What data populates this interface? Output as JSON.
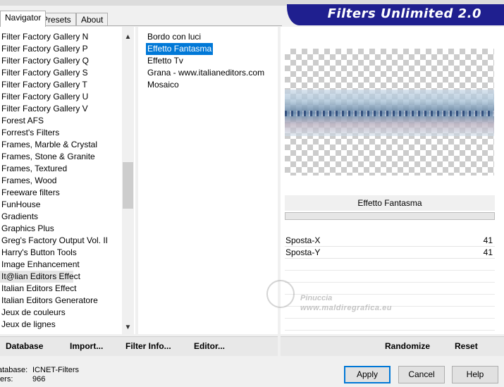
{
  "tabs": [
    {
      "label": "Navigator",
      "active": true
    },
    {
      "label": "Presets",
      "active": false
    },
    {
      "label": "About",
      "active": false
    }
  ],
  "banner": {
    "title": "Filters Unlimited 2.0"
  },
  "categories": [
    "Filter Factory Gallery N",
    "Filter Factory Gallery P",
    "Filter Factory Gallery Q",
    "Filter Factory Gallery S",
    "Filter Factory Gallery T",
    "Filter Factory Gallery U",
    "Filter Factory Gallery V",
    "Forest AFS",
    "Forrest's Filters",
    "Frames, Marble & Crystal",
    "Frames, Stone & Granite",
    "Frames, Textured",
    "Frames, Wood",
    "Freeware filters",
    "FunHouse",
    "Gradients",
    "Graphics Plus",
    "Greg's Factory Output Vol. II",
    "Harry's Button Tools",
    "Image Enhancement",
    "It@lian Editors Effect",
    "Italian Editors Effect",
    "Italian Editors Generatore",
    "Jeux de couleurs",
    "Jeux de lignes"
  ],
  "selected_category": "It@lian Editors Effect",
  "filters": [
    "Bordo con luci",
    "Effetto Fantasma",
    "Effetto Tv",
    "Grana - www.italianeditors.com",
    "Mosaico"
  ],
  "selected_filter": "Effetto Fantasma",
  "filter_name": "Effetto Fantasma",
  "params": [
    {
      "label": "Sposta-X",
      "value": "41"
    },
    {
      "label": "Sposta-Y",
      "value": "41"
    }
  ],
  "watermark": {
    "line1": "Pinuccia",
    "line2": "www.maldiregrafica.eu"
  },
  "bottom_links": {
    "database": "Database",
    "import": "Import...",
    "filter_info": "Filter Info...",
    "editor": "Editor...",
    "randomize": "Randomize",
    "reset": "Reset"
  },
  "status": {
    "database_label": "atabase:",
    "database_value": "ICNET-Filters",
    "filters_label": "ters:",
    "filters_value": "966"
  },
  "buttons": {
    "apply": "Apply",
    "cancel": "Cancel",
    "help": "Help"
  },
  "colors": {
    "banner": "#1f1f8f",
    "selection": "#0078d7"
  },
  "icons": {
    "scroll_up": "▲",
    "scroll_down": "▼"
  }
}
